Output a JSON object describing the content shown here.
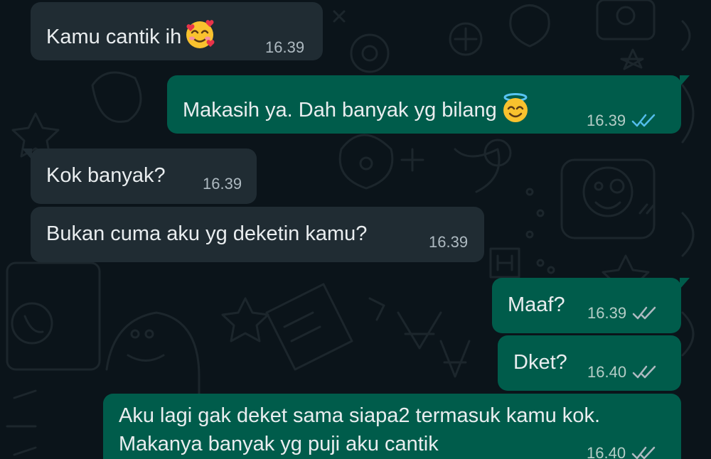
{
  "messages": [
    {
      "direction": "incoming",
      "text": "Kamu cantik ih",
      "emoji": "smiling-face-with-hearts",
      "time": "16.39"
    },
    {
      "direction": "outgoing",
      "text": "Makasih ya. Dah banyak yg bilang",
      "emoji": "smiling-face-with-halo",
      "time": "16.39",
      "status": "read"
    },
    {
      "direction": "incoming",
      "text": "Kok banyak?",
      "time": "16.39"
    },
    {
      "direction": "incoming",
      "text": "Bukan cuma aku yg deketin kamu?",
      "time": "16.39"
    },
    {
      "direction": "outgoing",
      "text": "Maaf?",
      "time": "16.39",
      "status": "delivered"
    },
    {
      "direction": "outgoing",
      "text": "Dket?",
      "time": "16.40",
      "status": "delivered"
    },
    {
      "direction": "outgoing",
      "text_line1": "Aku lagi gak deket sama siapa2 termasuk kamu kok.",
      "text_line2": "Makanya banyak yg puji aku cantik",
      "time": "16.40",
      "status": "delivered"
    }
  ],
  "colors": {
    "background": "#0b141a",
    "incoming_bubble": "#202c33",
    "outgoing_bubble": "#005c4b",
    "read_tick": "#53bdeb",
    "delivered_tick": "#aebac1"
  }
}
